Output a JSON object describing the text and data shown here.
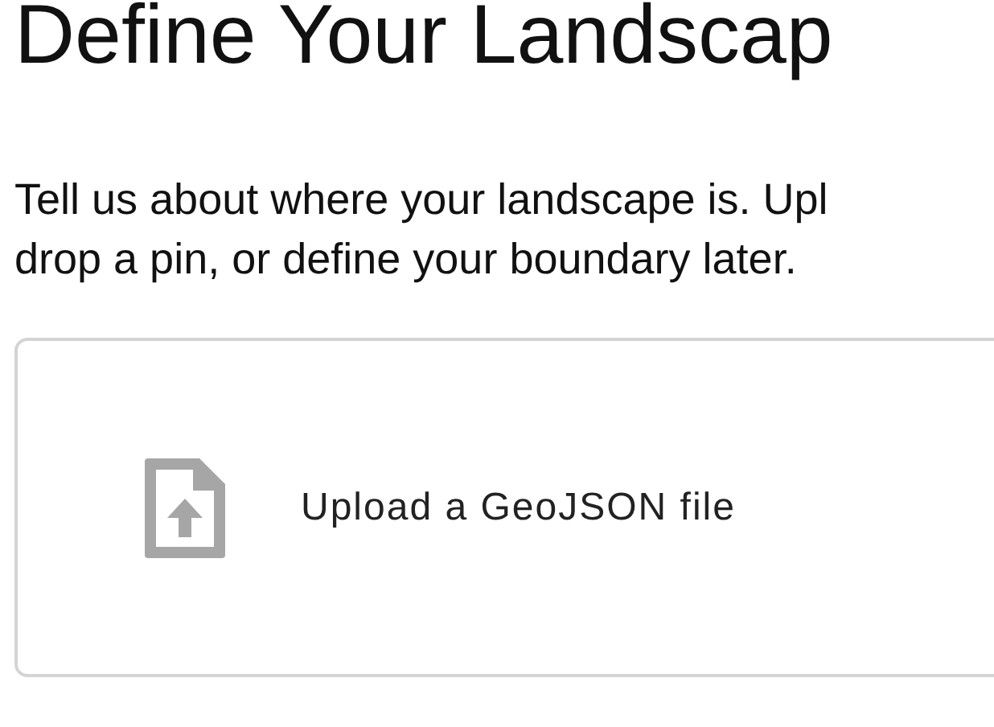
{
  "heading": "Define Your Landscap",
  "intro": "Tell us about where your landscape is. Upl\ndrop a pin, or define your boundary later.",
  "upload_option": {
    "label": "Upload a GeoJSON file"
  }
}
